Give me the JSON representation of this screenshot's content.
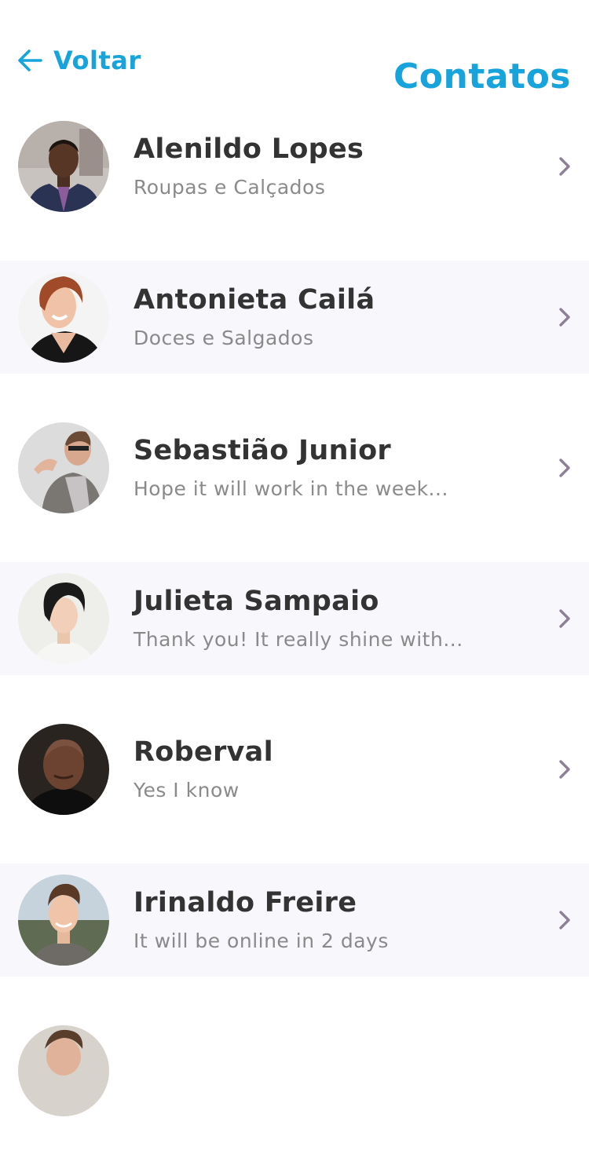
{
  "header": {
    "back_label": "Voltar",
    "title": "Contatos"
  },
  "colors": {
    "accent": "#17a4dc",
    "name_text": "#333333",
    "message_text": "#8a8a8a",
    "chevron": "#8e7f97",
    "alt_row_bg": "#f8f8fc"
  },
  "contacts": [
    {
      "name": "Alenildo Lopes",
      "message": "Roupas e Calçados"
    },
    {
      "name": "Antonieta Cailá",
      "message": "Doces e Salgados"
    },
    {
      "name": "Sebastião Junior",
      "message": "Hope it will work in the week..."
    },
    {
      "name": "Julieta Sampaio",
      "message": "Thank you! It really shine with..."
    },
    {
      "name": "Roberval",
      "message": "Yes I know"
    },
    {
      "name": "Irinaldo Freire",
      "message": "It will be online in 2 days"
    }
  ]
}
